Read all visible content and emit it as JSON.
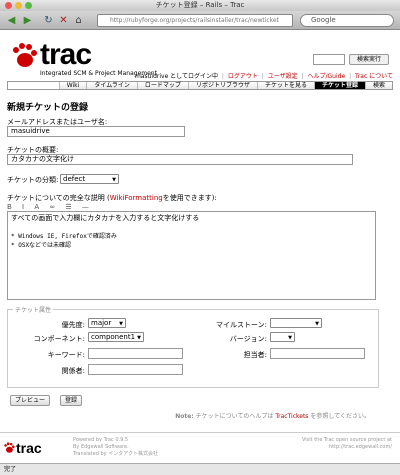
{
  "window": {
    "title": "チケット登録 – Rails – Trac"
  },
  "browser": {
    "url": "http://rubyforge.org/projects/railsinstaller/trac/newticket",
    "search_value": "Google"
  },
  "header": {
    "logo_text": "trac",
    "logo_subtitle": "Integrated SCM & Project Management",
    "search_button": "検索実行",
    "login_text": "masuidrive としてログイン中",
    "meta_links": [
      "ログアウト",
      "ユーザ設定",
      "ヘルプ/Guide",
      "Trac について"
    ]
  },
  "mainnav": [
    "Wiki",
    "タイムライン",
    "ロードマップ",
    "リポジトリブラウザ",
    "チケットを見る",
    "チケット登録",
    "検索"
  ],
  "form": {
    "heading": "新規チケットの登録",
    "reporter_label": "メールアドレスまたはユーザ名:",
    "reporter_value": "masuidrive",
    "summary_label": "チケットの概要:",
    "summary_value": "カタカナの文字化け",
    "type_label": "チケットの分類:",
    "type_value": "defect",
    "description_label_pre": "チケットについての完全な説明 (",
    "description_link": "WikiFormatting",
    "description_label_post": "を使用できます):",
    "wiki_toolbar": "B I A ∞ ☰ —",
    "description_line1": "すべての画面で入力欄にカタカナを入力すると文字化けする",
    "description_line2": "* Windows IE, Firefoxで確認済み",
    "description_line3": "* OSXなどでは未確認",
    "properties_legend": "チケット属性",
    "priority_label": "優先度:",
    "priority_value": "major",
    "component_label": "コンポーネント:",
    "component_value": "component1",
    "keywords_label": "キーワード:",
    "cc_label": "関係者:",
    "milestone_label": "マイルストーン:",
    "milestone_value": "",
    "version_label": "バージョン:",
    "version_value": "",
    "owner_label": "担当者:",
    "preview_button": "プレビュー",
    "submit_button": "登録"
  },
  "note": {
    "label": "Note:",
    "pre": " チケットについてのヘルプは ",
    "link": "TracTickets",
    "post": " を参照してください。"
  },
  "footer": {
    "logo_text": "trac",
    "left_line1": "Powered by Trac 0.9.5",
    "left_line2": "By Edgewall Software.",
    "left_line3": "Translated by インタアクト株式会社",
    "right_line1": "Visit the Trac open source project at",
    "right_line2": "http://trac.edgewall.com/"
  },
  "status_bar": "完了",
  "colors": {
    "accent": "#bb0000",
    "nav_active_bg": "#000000",
    "paw": "#cc0000"
  }
}
